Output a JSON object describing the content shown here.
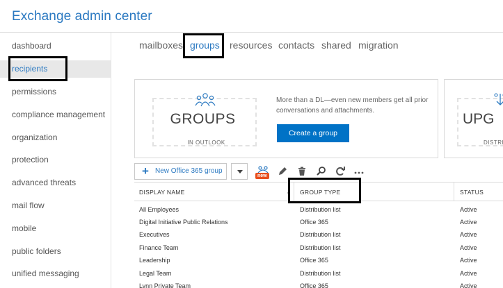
{
  "app": {
    "title": "Exchange admin center"
  },
  "sidebar": {
    "items": [
      {
        "label": "dashboard"
      },
      {
        "label": "recipients"
      },
      {
        "label": "permissions"
      },
      {
        "label": "compliance management"
      },
      {
        "label": "organization"
      },
      {
        "label": "protection"
      },
      {
        "label": "advanced threats"
      },
      {
        "label": "mail flow"
      },
      {
        "label": "mobile"
      },
      {
        "label": "public folders"
      },
      {
        "label": "unified messaging"
      }
    ],
    "active": "recipients"
  },
  "tabs": [
    {
      "label": "mailboxes"
    },
    {
      "label": "groups"
    },
    {
      "label": "resources"
    },
    {
      "label": "contacts"
    },
    {
      "label": "shared"
    },
    {
      "label": "migration"
    }
  ],
  "active_tab": "groups",
  "promo": {
    "big": "GROUPS",
    "sub": "IN OUTLOOK",
    "text": "More than a DL—even new members get all prior conversations and attachments.",
    "button": "Create a group"
  },
  "promo2": {
    "big": "UPG",
    "sub": "DISTRI"
  },
  "toolbar": {
    "new_label": "New Office 365 group",
    "new_badge": "new",
    "icons": [
      "upgrade-icon",
      "pencil-icon",
      "trash-icon",
      "search-icon",
      "refresh-icon",
      "more-icon"
    ]
  },
  "table": {
    "columns": [
      "DISPLAY NAME",
      "GROUP TYPE",
      "STATUS"
    ],
    "rows": [
      {
        "name": "All Employees",
        "type": "Distribution list",
        "status": "Active"
      },
      {
        "name": "Digital Initiative Public Relations",
        "type": "Office 365",
        "status": "Active"
      },
      {
        "name": "Executives",
        "type": "Distribution list",
        "status": "Active"
      },
      {
        "name": "Finance Team",
        "type": "Distribution list",
        "status": "Active"
      },
      {
        "name": "Leadership",
        "type": "Office 365",
        "status": "Active"
      },
      {
        "name": "Legal Team",
        "type": "Distribution list",
        "status": "Active"
      },
      {
        "name": "Lynn Private Team",
        "type": "Office 365",
        "status": "Active"
      }
    ]
  },
  "colors": {
    "accent": "#2b79c1",
    "button": "#0072c6",
    "badge": "#e84f1e"
  }
}
